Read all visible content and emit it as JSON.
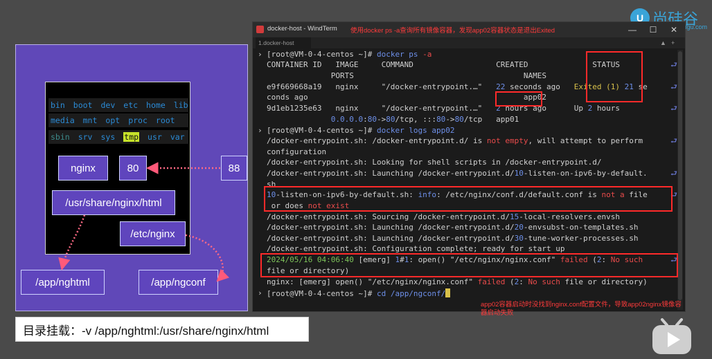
{
  "slide": {
    "dir_row1": [
      "bin",
      "boot",
      "dev",
      "etc",
      "home",
      "lib"
    ],
    "dir_row2": [
      "media",
      "mnt",
      "opt",
      "proc",
      "root"
    ],
    "dir_row3": [
      "sbin",
      "srv",
      "sys",
      "tmp",
      "usr",
      "var"
    ],
    "nginx_label": "nginx",
    "container_port": "80",
    "host_port": "88",
    "container_html_path": "/usr/share/nginx/html",
    "container_conf_path": "/etc/nginx",
    "host_html_path": "/app/nghtml",
    "host_conf_path": "/app/ngconf",
    "caption": "目录挂载：-v /app/nghtml:/usr/share/nginx/html"
  },
  "window": {
    "title": "docker-host - WindTerm",
    "annotation": "使用docker ps -a查询所有镜像容器，发现app02容器状态是退出Exited",
    "tab": "1.docker-host",
    "minimize": "—",
    "maximize": "☐",
    "close": "✕"
  },
  "terminal": {
    "l1_prompt": "[root@VM-0-4-centos ~]# ",
    "l1_cmd": "docker ps",
    "l1_flag": " -a",
    "l2": "CONTAINER ID   IMAGE     COMMAND                  CREATED              STATUS",
    "l3": "              PORTS                                     NAMES",
    "l4_a": "e9f669668a19   nginx     \"/docker-entrypoint.…\"   ",
    "l4_b": "22",
    "l4_c": " seconds ago   ",
    "l4_d": "Exited (1) ",
    "l4_e": "21",
    "l4_f": " se",
    "l5_a": "conds ago                                               ",
    "l5_b": "app02",
    "l6_a": "9d1eb1235e63   nginx     \"/docker-entrypoint.…\"   ",
    "l6_b": "2",
    "l6_c": " hours ago      Up ",
    "l6_d": "2",
    "l6_e": " hours",
    "l7_a": "              ",
    "l7_b": "0.0.0.0",
    "l7_c": ":",
    "l7_d": "80",
    "l7_e": "->",
    "l7_f": "80",
    "l7_g": "/tcp, :::",
    "l7_h": "80",
    "l7_i": "->",
    "l7_j": "80",
    "l7_k": "/tcp   app01",
    "l8_prompt": "[root@VM-0-4-centos ~]# ",
    "l8_cmd": "docker logs app02",
    "l9_a": "/docker-entrypoint.sh: /docker-entrypoint.d/ is ",
    "l9_b": "not empty",
    "l9_c": ", will attempt to perform",
    "l10": "configuration",
    "l11": "/docker-entrypoint.sh: Looking for shell scripts in /docker-entrypoint.d/",
    "l12_a": "/docker-entrypoint.sh: Launching /docker-entrypoint.d/",
    "l12_b": "10",
    "l12_c": "-listen-on-ipv6-by-default.",
    "l13": "sh",
    "l14_a": "10",
    "l14_b": "-listen-on-ipv6-by-default.sh: ",
    "l14_c": "info",
    "l14_d": ": /etc/nginx/conf.d/default.conf is ",
    "l14_e": "not a",
    "l14_f": " file",
    "l15_a": " or does ",
    "l15_b": "not exist",
    "l16_a": "/docker-entrypoint.sh: Sourcing /docker-entrypoint.d/",
    "l16_b": "15",
    "l16_c": "-local-resolvers.envsh",
    "l17_a": "/docker-entrypoint.sh: Launching /docker-entrypoint.d/",
    "l17_b": "20",
    "l17_c": "-envsubst-on-templates.sh",
    "l18_a": "/docker-entrypoint.sh: Launching /docker-entrypoint.d/",
    "l18_b": "30",
    "l18_c": "-tune-worker-processes.sh",
    "l19": "/docker-entrypoint.sh: Configuration complete; ready for start up",
    "l20_a": "2024/05/16 04:06:40",
    "l20_b": " [emerg] ",
    "l20_c": "1",
    "l20_d": "#",
    "l20_e": "1",
    "l20_f": ": open() \"/etc/nginx/nginx.conf\" ",
    "l20_g": "failed",
    "l20_h": " (",
    "l20_i": "2",
    "l20_j": ": ",
    "l20_k": "No such",
    "l21": "file or directory)",
    "l22_a": "nginx: [emerg] open() \"/etc/nginx/nginx.conf\" ",
    "l22_b": "failed",
    "l22_c": " (",
    "l22_d": "2",
    "l22_e": ": ",
    "l22_f": "No such",
    "l22_g": " file or directory)",
    "l23_prompt": "[root@VM-0-4-centos ~]# ",
    "l23_cmd": "cd /app/ngconf/",
    "wrap_glyph": "⮐",
    "prompt_glyph": "›"
  },
  "bottom_annotation": "app02容器启动时没找到nginx.conf配置文件，导致app02nginx镜像容器启动失败",
  "logo": {
    "mark": "U",
    "text": "尚硅谷",
    "sub": "atguigu.com"
  },
  "colors": {
    "slide_bg": "#6048b8",
    "annotation_red": "#ff2a2a",
    "cmd_blue": "#6d8fe8",
    "error_red": "#e94b4b",
    "warn_yellow": "#d8c14a",
    "number_blue": "#6d8fe8"
  }
}
